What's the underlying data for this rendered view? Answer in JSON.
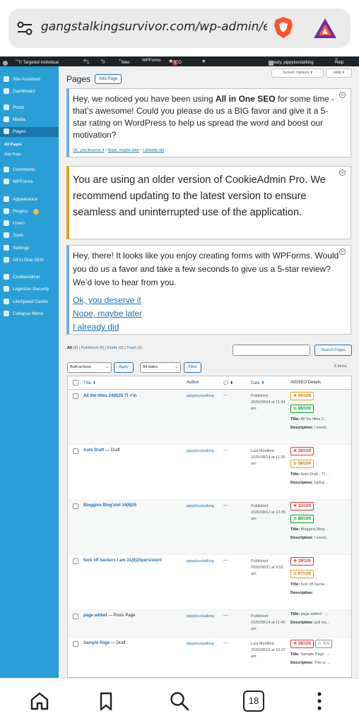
{
  "browser": {
    "url": "gangstalkingsurvivor.com/wp-admin/edi",
    "tab_count": "18"
  },
  "adminbar": {
    "site_name": "TI Targeted Individual",
    "updates": "1",
    "comments": "0",
    "new_label": "New",
    "wpforms": "WPForms",
    "seo": "SEO",
    "seo_count": "3",
    "howdy": "Howdy, pippyluvstalking",
    "help": "Help"
  },
  "sidebar": {
    "items": [
      {
        "label": "Site Assistant",
        "icon": "magic-icon"
      },
      {
        "label": "Dashboard",
        "icon": "dashboard-icon"
      },
      {
        "label": "Posts",
        "icon": "pin-icon"
      },
      {
        "label": "Media",
        "icon": "media-icon"
      },
      {
        "label": "Pages",
        "icon": "page-icon"
      },
      {
        "label": "Comments",
        "icon": "comment-icon"
      },
      {
        "label": "WPForms",
        "icon": "form-icon"
      },
      {
        "label": "Appearance",
        "icon": "brush-icon"
      },
      {
        "label": "Plugins",
        "icon": "plugin-icon"
      },
      {
        "label": "Users",
        "icon": "user-icon"
      },
      {
        "label": "Tools",
        "icon": "wrench-icon"
      },
      {
        "label": "Settings",
        "icon": "settings-icon"
      },
      {
        "label": "All in One SEO",
        "icon": "seo-icon"
      },
      {
        "label": "CookieAdmin",
        "icon": "cookie-icon"
      },
      {
        "label": "Loginizer Security",
        "icon": "gear-icon"
      },
      {
        "label": "LiteSpeed Cache",
        "icon": "diamond-icon"
      },
      {
        "label": "Collapse Menu",
        "icon": "collapse-icon"
      }
    ],
    "sub_all_pages": "All Pages",
    "sub_add_page": "Add Page",
    "plugins_badge": "1"
  },
  "header": {
    "title": "Pages",
    "add_page": "Add Page",
    "screen_options": "Screen Options ▾",
    "help": "Help ▾"
  },
  "notices": {
    "n1_pre": "Hey, we noticed you have been using ",
    "n1_bold": "All in One SEO",
    "n1_post": " for some time - that’s awesome! Could you please do us a BIG favor and give it a 5-star rating on WordPress to help us spread the word and boost our motivation?",
    "n1_link1": "Ok, you deserve it",
    "n1_link2": "Nope, maybe later",
    "n1_link3": "I already did",
    "n2_text": "You are using an older version of CookieAdmin Pro. We recommend updating to the latest version to ensure seamless and uninterrupted use of the application.",
    "n3_text": "Hey, there! It looks like you enjoy creating forms with WPForms. Would you do us a favor and take a few seconds to give us a 5-star review? We’d love to hear from you.",
    "n3_link1": "Ok, you deserve it",
    "n3_link2": "Nope, maybe later",
    "n3_link3": "I already did"
  },
  "filters": {
    "all": "All",
    "all_count": "(8)",
    "published": "Published",
    "published_count": "(6)",
    "drafts": "Drafts",
    "drafts_count": "(2)",
    "trash": "Trash",
    "trash_count": "(2)",
    "search_button": "Search Pages",
    "bulk_actions": "Bulk actions",
    "apply": "Apply",
    "all_dates": "All dates",
    "filter": "Filter",
    "items_count": "8 items"
  },
  "table": {
    "headers": {
      "title": "Title ⬍",
      "author": "Author",
      "comments": "💬 ⬍",
      "date": "Date ⬍",
      "aioseo": "AIOSEO Details"
    },
    "rows": [
      {
        "title": "All the titles 24(8)25 TI ✔in",
        "state": "",
        "author": "pippyluvstalking",
        "comments": "—",
        "date_status": "Published",
        "date": "2025/08/14 at 11:34 am",
        "seo": "50/100",
        "seo_color": "orange",
        "trueseo": "86/100",
        "trueseo_color": "green",
        "meta_title": "Title: All the titles 2...",
        "meta_desc": "Description: I wond..."
      },
      {
        "title": "Auto Draft",
        "state": " — Draft",
        "author": "pippyluvstalking",
        "comments": "—",
        "date_status": "Last Modified",
        "date": "2025/08/14 at 11:36 am",
        "seo": "28/100",
        "seo_color": "red",
        "trueseo": "58/100",
        "trueseo_color": "orange",
        "meta_title": "Title: Auto Draft - TI ...",
        "meta_desc": "Description: typing ..."
      },
      {
        "title": "Bloggins Blog'alot 14(8)25",
        "state": "",
        "author": "pippyluvstalking",
        "comments": "—",
        "date_status": "Published",
        "date": "2025/08/12 at 10:35 am",
        "seo": "33/100",
        "seo_color": "red",
        "trueseo": "80/100",
        "trueseo_color": "green",
        "meta_title": "Title: Bloggins Blog'...",
        "meta_desc": "Description: I wond..."
      },
      {
        "title": "fuck off hackers I am 31(8)25persistent",
        "state": "",
        "author": "pippyluvstalking",
        "comments": "—",
        "date_status": "Published",
        "date": "2025/08/31 at 9:52 am",
        "seo": "39/100",
        "seo_color": "red",
        "trueseo": "67/100",
        "trueseo_color": "orange",
        "meta_title": "Title: fuck off hacke...",
        "meta_desc": "Description:"
      },
      {
        "title": "page added",
        "state": " — Posts Page",
        "author": "pippyluvstalking",
        "comments": "—",
        "date_status": "Published",
        "date": "2025/08/14 at 11:40 am",
        "seo": "",
        "seo_color": "",
        "trueseo": "",
        "trueseo_color": "",
        "meta_title": "Title: page added - ...",
        "meta_desc": "Description: pull my..."
      },
      {
        "title": "Sample Page",
        "state": " — Draft",
        "author": "pippyluvstalking",
        "comments": "—",
        "date_status": "Last Modified",
        "date": "2025/08/12 at 10:27 am",
        "seo": "28/100",
        "seo_color": "red",
        "trueseo": "N/A",
        "trueseo_color": "gray",
        "meta_title": "Title: Sample Page -...",
        "meta_desc": "Description: This is ..."
      }
    ]
  },
  "nav": {
    "home": "home-icon",
    "bookmark": "bookmark-icon",
    "search": "search-icon",
    "tabs": "18",
    "menu": "more-icon"
  }
}
